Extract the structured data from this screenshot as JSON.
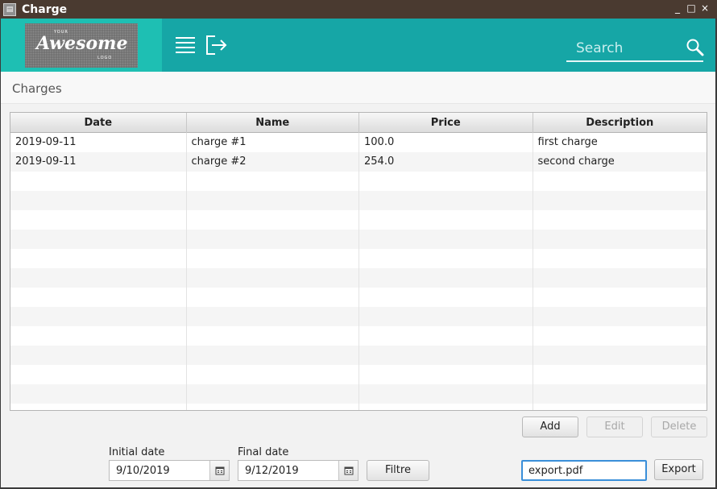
{
  "window": {
    "title": "Charge",
    "controls": [
      "_",
      "□",
      "×"
    ]
  },
  "header": {
    "logo": {
      "line1": "YOUR",
      "line2": "Awesome",
      "line3": "LOGO"
    },
    "menu_icon": "hamburger-menu-icon",
    "logout_icon": "logout-icon",
    "search_placeholder": "Search",
    "search_icon": "search-icon",
    "accent_color": "#16a6a6"
  },
  "breadcrumb": "Charges",
  "table": {
    "columns": [
      "Date",
      "Name",
      "Price",
      "Description"
    ],
    "rows": [
      [
        "2019-09-11",
        "charge #1",
        "100.0",
        "first charge"
      ],
      [
        "2019-09-11",
        "charge #2",
        "254.0",
        "second charge"
      ]
    ]
  },
  "actions": {
    "add": "Add",
    "edit": "Edit",
    "delete": "Delete"
  },
  "filter": {
    "initial_label": "Initial date",
    "initial_value": "9/10/2019",
    "final_label": "Final date",
    "final_value": "9/12/2019",
    "button": "Filtre"
  },
  "export": {
    "filename": "export.pdf",
    "button": "Export"
  }
}
